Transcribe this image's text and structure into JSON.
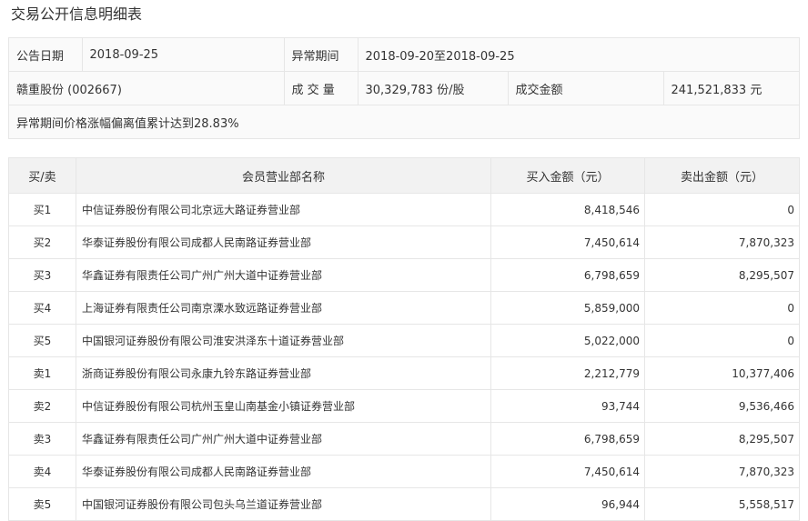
{
  "page": {
    "title": "交易公开信息明细表"
  },
  "summary": {
    "announce_date_label": "公告日期",
    "announce_date": "2018-09-25",
    "abnormal_period_label": "异常期间",
    "abnormal_period": "2018-09-20至2018-09-25",
    "stock": "赣重股份 (002667)",
    "volume_label": "成 交 量",
    "volume": "30,329,783 份/股",
    "amount_label": "成交金额",
    "amount": "241,521,833 元",
    "reason": "异常期间价格涨幅偏离值累计达到28.83%"
  },
  "table": {
    "headers": [
      "买/卖",
      "会员营业部名称",
      "买入金额（元）",
      "卖出金额（元）"
    ],
    "rows": [
      {
        "side": "买1",
        "name": "中信证券股份有限公司北京远大路证券营业部",
        "buy": "8,418,546",
        "sell": "0"
      },
      {
        "side": "买2",
        "name": "华泰证券股份有限公司成都人民南路证券营业部",
        "buy": "7,450,614",
        "sell": "7,870,323"
      },
      {
        "side": "买3",
        "name": "华鑫证券有限责任公司广州广州大道中证券营业部",
        "buy": "6,798,659",
        "sell": "8,295,507"
      },
      {
        "side": "买4",
        "name": "上海证券有限责任公司南京溧水致远路证券营业部",
        "buy": "5,859,000",
        "sell": "0"
      },
      {
        "side": "买5",
        "name": "中国银河证券股份有限公司淮安洪泽东十道证券营业部",
        "buy": "5,022,000",
        "sell": "0"
      },
      {
        "side": "卖1",
        "name": "浙商证券股份有限公司永康九铃东路证券营业部",
        "buy": "2,212,779",
        "sell": "10,377,406"
      },
      {
        "side": "卖2",
        "name": "中信证券股份有限公司杭州玉皇山南基金小镇证券营业部",
        "buy": "93,744",
        "sell": "9,536,466"
      },
      {
        "side": "卖3",
        "name": "华鑫证券有限责任公司广州广州大道中证券营业部",
        "buy": "6,798,659",
        "sell": "8,295,507"
      },
      {
        "side": "卖4",
        "name": "华泰证券股份有限公司成都人民南路证券营业部",
        "buy": "7,450,614",
        "sell": "7,870,323"
      },
      {
        "side": "卖5",
        "name": "中国银河证券股份有限公司包头乌兰道证券营业部",
        "buy": "96,944",
        "sell": "5,558,517"
      }
    ]
  }
}
